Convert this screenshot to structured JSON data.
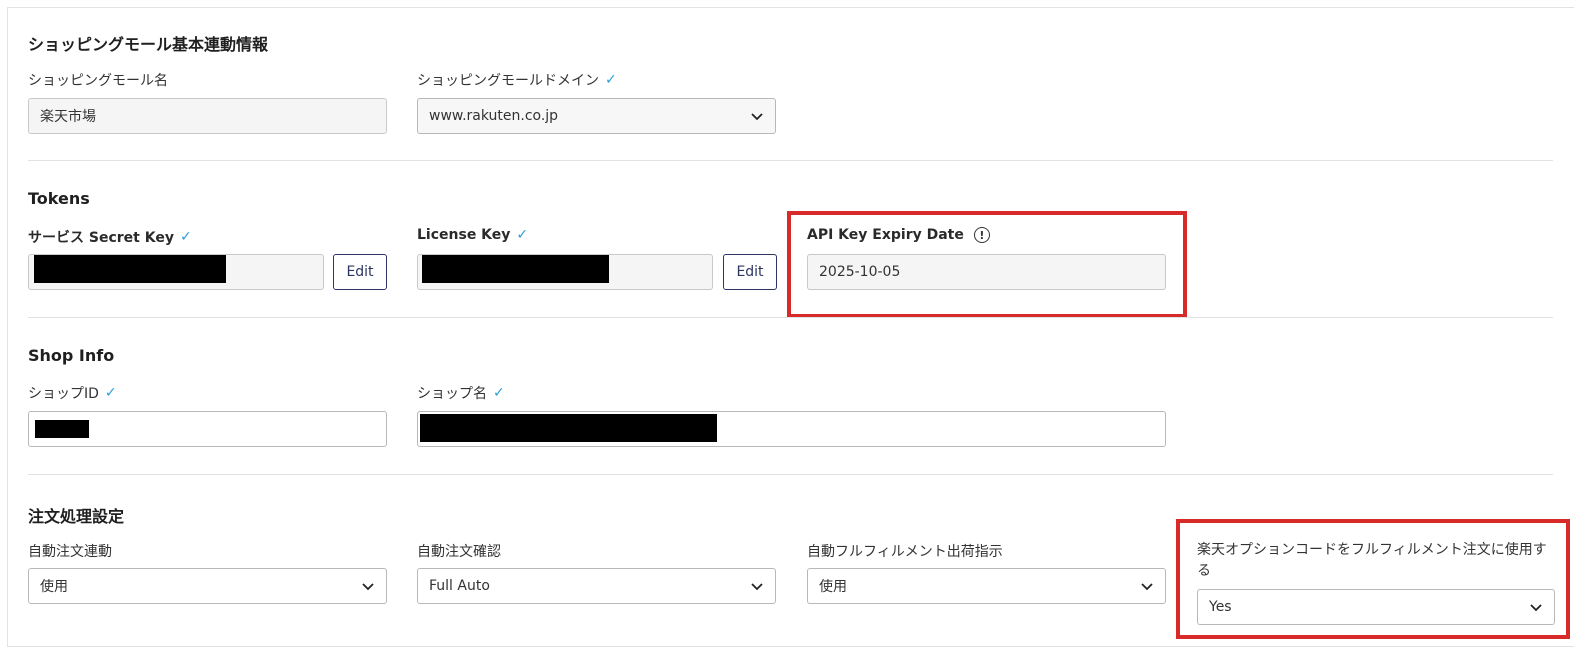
{
  "mall_section": {
    "title": "ショッピングモール基本連動情報",
    "mall_name_label": "ショッピングモール名",
    "mall_name_value": "楽天市場",
    "mall_domain_label": "ショッピングモールドメイン",
    "mall_domain_value": "www.rakuten.co.jp"
  },
  "tokens": {
    "title": "Tokens",
    "secret_key_label": "サービス Secret Key",
    "license_key_label": "License Key",
    "edit_label": "Edit",
    "expiry_label": "API Key Expiry Date",
    "expiry_value": "2025-10-05"
  },
  "shop_info": {
    "title": "Shop Info",
    "shop_id_label": "ショップID",
    "shop_name_label": "ショップ名"
  },
  "order_settings": {
    "title": "注文処理設定",
    "auto_order_link_label": "自動注文連動",
    "auto_order_link_value": "使用",
    "auto_order_confirm_label": "自動注文確認",
    "auto_order_confirm_value": "Full Auto",
    "auto_fulfillment_label": "自動フルフィルメント出荷指示",
    "auto_fulfillment_value": "使用",
    "option_code_label": "楽天オプションコードをフルフィルメント注文に使用する",
    "option_code_value": "Yes"
  },
  "icons": {
    "verified": "check-icon",
    "dropdown": "chevron-down-icon",
    "info": "info-icon"
  },
  "colors": {
    "highlight": "#d92a2a",
    "check": "#2b9fd8",
    "button_border": "#2c3564"
  }
}
